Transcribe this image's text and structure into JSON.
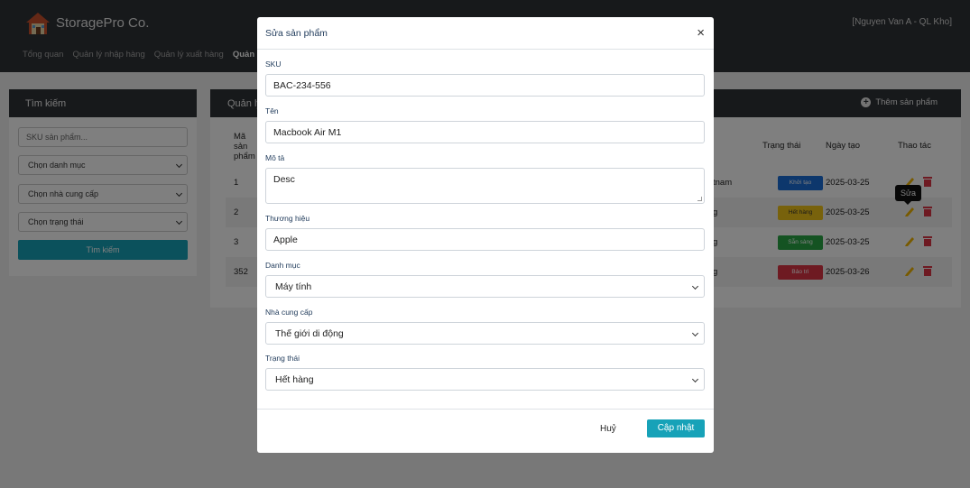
{
  "header": {
    "brand": "StoragePro Co.",
    "user": "[Nguyen Van A - QL Kho]",
    "nav": [
      "Tổng quan",
      "Quản lý nhập hàng",
      "Quản lý xuất hàng",
      "Quản lý sả"
    ]
  },
  "search": {
    "title": "Tìm kiếm",
    "sku_placeholder": "SKU sản phẩm...",
    "category_select": "Chọn danh mục",
    "supplier_select": "Chọn nhà cung cấp",
    "status_select": "Chọn trạng thái",
    "button": "Tìm kiếm"
  },
  "table": {
    "title": "Quản lý",
    "add_button": "Thêm sản phẩm",
    "headers": {
      "code": "Mã\nsản\nphẩm",
      "status": "Trạng thái",
      "created": "Ngày tạo",
      "actions": "Thao tác"
    },
    "rows": [
      {
        "code": "1",
        "partial": "tnam",
        "status": "Khởi tạo",
        "status_color": "#1a6fd8",
        "date": "2025-03-25"
      },
      {
        "code": "2",
        "partial": "g",
        "status": "Hết hàng",
        "status_color": "#f0c419",
        "date": "2025-03-25"
      },
      {
        "code": "3",
        "partial": "g",
        "status": "Sẵn sàng",
        "status_color": "#28a745",
        "date": "2025-03-25"
      },
      {
        "code": "352",
        "partial": "g",
        "status": "Bảo trì",
        "status_color": "#dc3545",
        "date": "2025-03-26"
      }
    ],
    "tooltip": "Sửa"
  },
  "modal": {
    "title": "Sửa sản phẩm",
    "close_icon": "×",
    "labels": {
      "sku": "SKU",
      "name": "Tên",
      "description": "Mô tả",
      "brand": "Thương hiệu",
      "category": "Danh mục",
      "supplier": "Nhà cung cấp",
      "status": "Trạng thái"
    },
    "values": {
      "sku": "BAC-234-556",
      "name": "Macbook Air M1",
      "description": "Desc",
      "brand": "Apple",
      "category": "Máy tính",
      "supplier": "Thế giới di động",
      "status": "Hết hàng"
    },
    "cancel": "Huỷ",
    "update": "Cập nhật"
  },
  "colors": {
    "dark": "#2f3237",
    "accent": "#17a2b8",
    "edit_icon": "#f0b400",
    "delete_icon": "#dc3545"
  }
}
